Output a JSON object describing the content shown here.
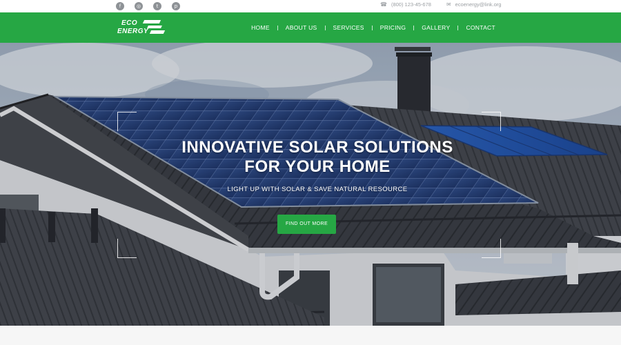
{
  "topbar": {
    "social_icons": [
      {
        "name": "facebook-icon",
        "glyph": "f"
      },
      {
        "name": "instagram-icon",
        "glyph": "◎"
      },
      {
        "name": "twitter-icon",
        "glyph": "t"
      },
      {
        "name": "pinterest-icon",
        "glyph": "p"
      }
    ],
    "phone_icon": "☎",
    "phone": "(800) 123-45-678",
    "email_icon": "✉",
    "email": "ecoenergy@link.org"
  },
  "header": {
    "logo_line1": "ECO",
    "logo_line2": "ENERGY",
    "nav": [
      "HOME",
      "ABOUT US",
      "SERVICES",
      "PRICING",
      "GALLERY",
      "CONTACT"
    ]
  },
  "hero": {
    "title_line1": "INNOVATIVE SOLAR SOLUTIONS",
    "title_line2": "FOR YOUR HOME",
    "subtitle": "LIGHT UP WITH SOLAR & SAVE NATURAL RESOURCE",
    "cta_label": "FIND OUT MORE"
  },
  "colors": {
    "brand_green": "#26a744",
    "sky": "#8fa1b6",
    "roof": "#3e4144",
    "panel_blue": "#2b4e93"
  }
}
